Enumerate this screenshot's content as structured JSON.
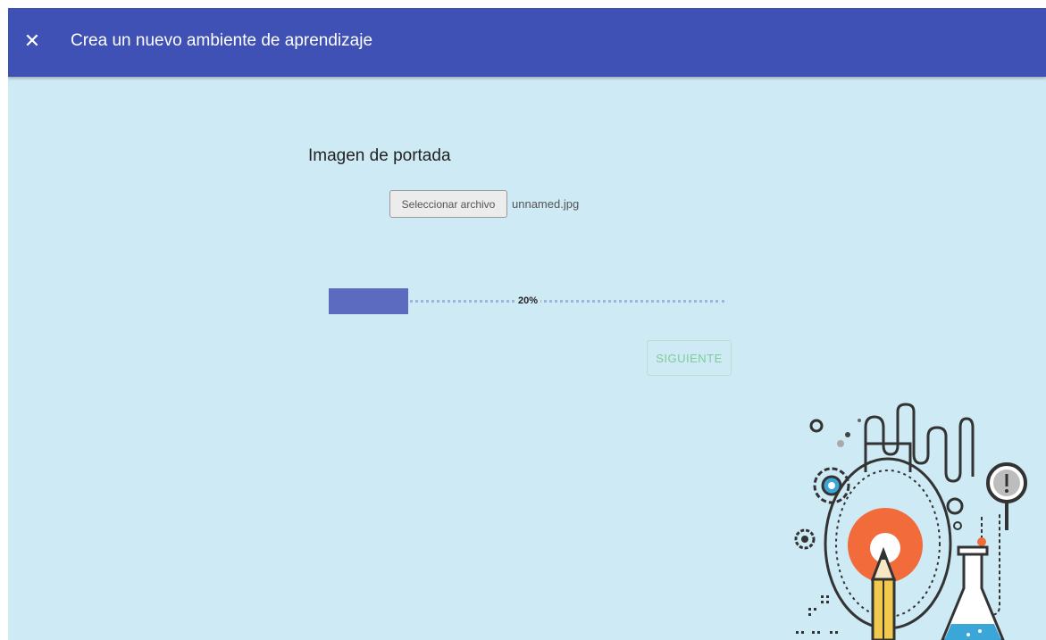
{
  "header": {
    "close_icon": "close-icon",
    "close_glyph": "✕",
    "title": "Crea un nuevo ambiente de aprendizaje"
  },
  "form": {
    "section_title": "Imagen de portada",
    "file_button_label": "Seleccionar archivo",
    "file_name": "unnamed.jpg"
  },
  "progress": {
    "value": 0.2,
    "label": "20%"
  },
  "actions": {
    "next_label": "SIGUIENTE"
  },
  "colors": {
    "header_bg": "#3f51b5",
    "page_bg": "#ceeaf4",
    "progress_fill": "#5c6bc0",
    "next_text": "#7ecb9b"
  }
}
